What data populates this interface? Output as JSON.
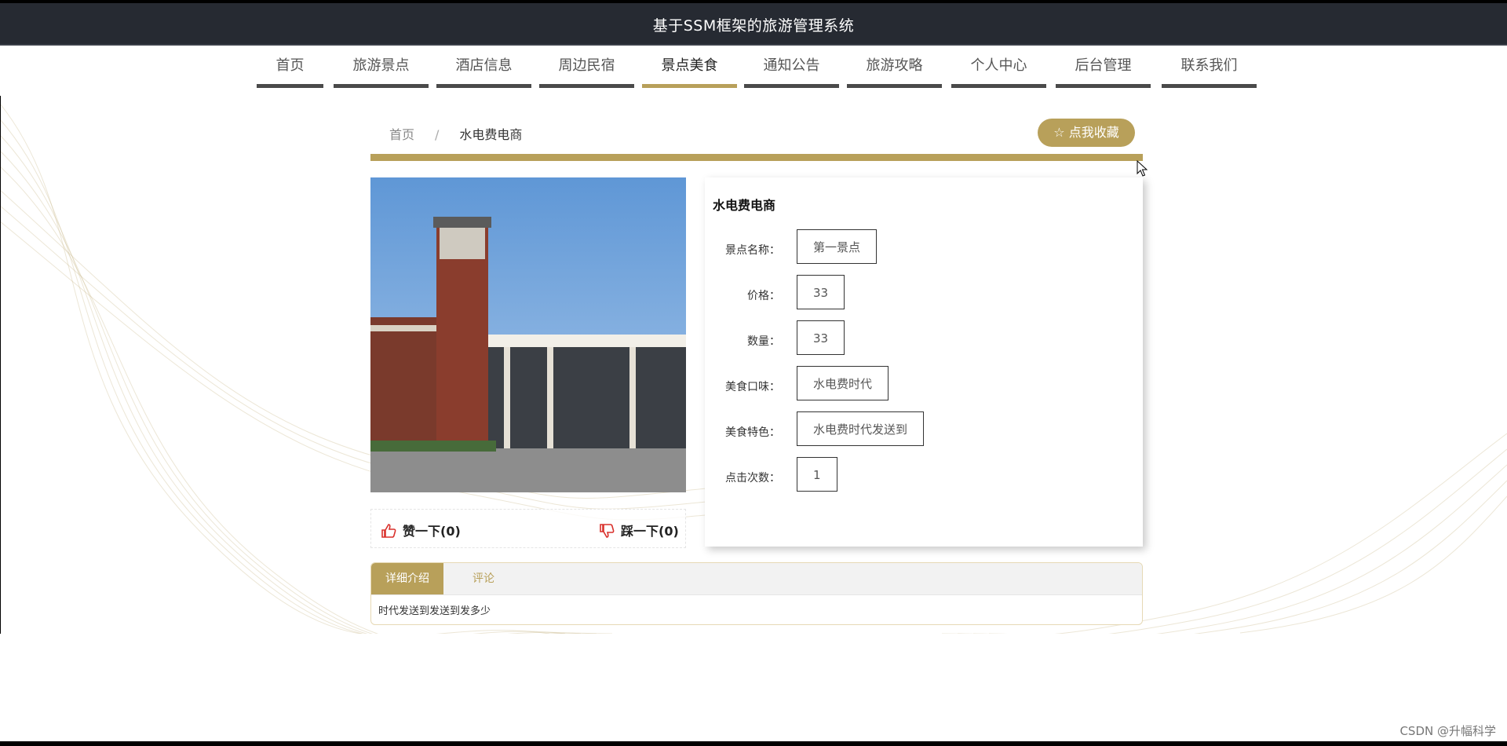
{
  "header": {
    "title": "基于SSM框架的旅游管理系统"
  },
  "nav": {
    "items": [
      {
        "label": "首页"
      },
      {
        "label": "旅游景点"
      },
      {
        "label": "酒店信息"
      },
      {
        "label": "周边民宿"
      },
      {
        "label": "景点美食"
      },
      {
        "label": "通知公告"
      },
      {
        "label": "旅游攻略"
      },
      {
        "label": "个人中心"
      },
      {
        "label": "后台管理"
      },
      {
        "label": "联系我们"
      }
    ],
    "active": "景点美食"
  },
  "breadcrumb": {
    "home": "首页",
    "separator": "/",
    "current": "水电费电商"
  },
  "favorite_button": {
    "icon": "star-outline-icon",
    "label": "☆ 点我收藏"
  },
  "detail": {
    "title": "水电费电商",
    "fields": [
      {
        "label": "景点名称：",
        "value": "第一景点"
      },
      {
        "label": "价格：",
        "value": "33"
      },
      {
        "label": "数量：",
        "value": "33"
      },
      {
        "label": "美食口味：",
        "value": "水电费时代"
      },
      {
        "label": "美食特色：",
        "value": "水电费时代发送到"
      },
      {
        "label": "点击次数：",
        "value": "1"
      }
    ]
  },
  "votes": {
    "like_label": "赞一下(0)",
    "dislike_label": "踩一下(0)",
    "like_icon": "thumbs-up-icon",
    "dislike_icon": "thumbs-down-icon"
  },
  "tabs": {
    "items": [
      {
        "label": "详细介绍"
      },
      {
        "label": "评论"
      }
    ],
    "content": "时代发送到发送到发多少"
  },
  "watermark": "CSDN @升幅科学",
  "colors": {
    "accent": "#b8a05a",
    "header_bg": "#262a32",
    "nav_underline": "#4a4a4a"
  }
}
